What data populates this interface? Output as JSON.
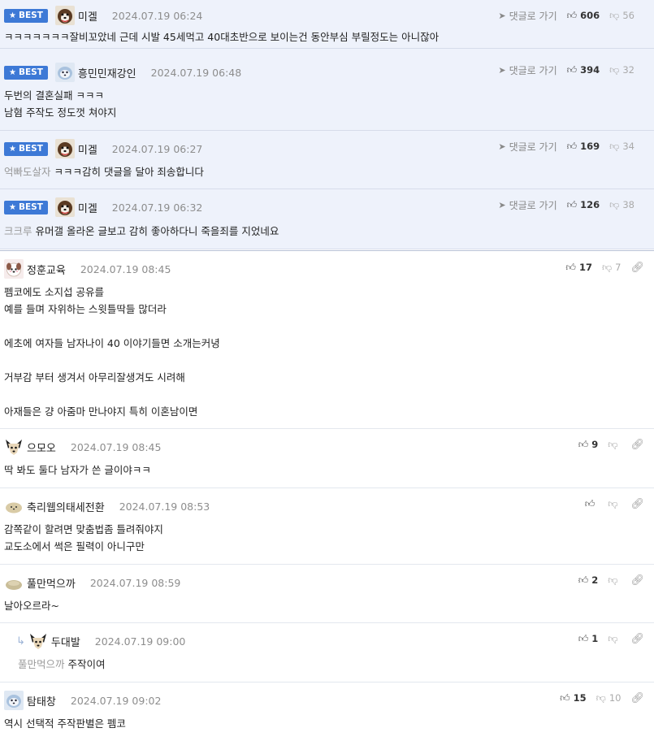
{
  "best_badge": "BEST",
  "labels": {
    "goto": "댓글로 가기"
  },
  "best_comments": [
    {
      "nick": "미겔",
      "time": "2024.07.19 06:24",
      "up": "606",
      "down": "56",
      "quote": "",
      "text": "ㅋㅋㅋㅋㅋㅋㅋ잘비꼬았네 근데 시발 45세먹고 40대초반으로 보이는건 동안부심 부릴정도는 아니잖아"
    },
    {
      "nick": "흥민민재강인",
      "time": "2024.07.19 06:48",
      "up": "394",
      "down": "32",
      "quote": "",
      "text": "두번의 결혼실패 ㅋㅋㅋ\n남혐 주작도 정도껏 쳐야지"
    },
    {
      "nick": "미겔",
      "time": "2024.07.19 06:27",
      "up": "169",
      "down": "34",
      "quote": "억빠도살자",
      "text": "ㅋㅋㅋ감히 댓글을 달아 죄송합니다"
    },
    {
      "nick": "미겔",
      "time": "2024.07.19 06:32",
      "up": "126",
      "down": "38",
      "quote": "크크루",
      "text": "유머갤 올라온 글보고 감히 좋아하다니 죽을죄를 지었네요"
    }
  ],
  "comments": [
    {
      "nick": "정훈교육",
      "time": "2024.07.19 08:45",
      "up": "17",
      "down": "7",
      "quote": "",
      "text": "펨코에도 소지섭 공유를\n예를 들며 자위하는 스윗틀딱들 많더라\n\n에초에 여자들 남자나이 40 이야기들면 소개는커녕\n\n거부감 부터 생겨서 아무리잘생겨도 시려해\n\n아재들은 걍 아줌마 만나야지 특히 이혼남이면"
    },
    {
      "nick": "으모오",
      "time": "2024.07.19 08:45",
      "up": "9",
      "down": "",
      "quote": "",
      "text": "딱 봐도 둘다 남자가 쓴 글이야ㅋㅋ"
    },
    {
      "nick": "축리웹의태세전환",
      "time": "2024.07.19 08:53",
      "up": "",
      "down": "",
      "quote": "",
      "text": "감쪽같이 할려면 맞춤법좀 틀려줘야지\n교도소에서 썩은 필력이 아니구만"
    },
    {
      "nick": "풀만먹으까",
      "time": "2024.07.19 08:59",
      "up": "2",
      "down": "",
      "quote": "",
      "text": "날아오르라~"
    },
    {
      "nick": "두대발",
      "time": "2024.07.19 09:00",
      "up": "1",
      "down": "",
      "quote": "풀만먹으까",
      "text": "주작이여"
    },
    {
      "nick": "탐태창",
      "time": "2024.07.19 09:02",
      "up": "15",
      "down": "10",
      "quote": "",
      "text": "역시 선택적 주작판별은 펨코"
    }
  ]
}
